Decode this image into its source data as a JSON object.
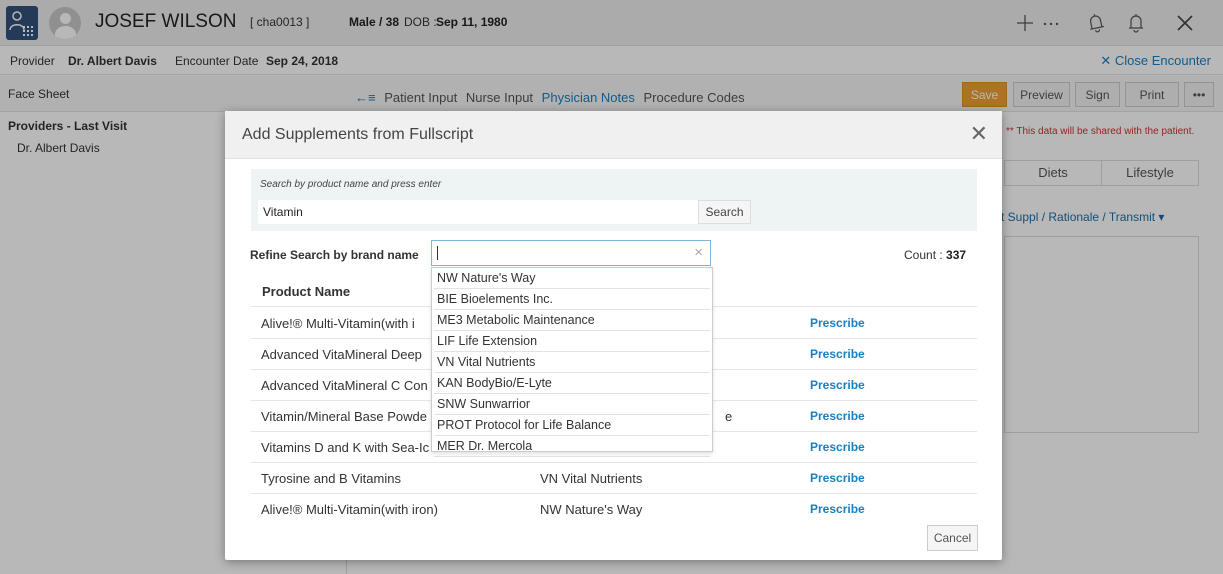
{
  "header": {
    "patient_name": "JOSEF WILSON",
    "patient_id": "[ cha0013 ]",
    "sex_age": "Male / 38",
    "dob_label": "DOB :",
    "dob": "Sep 11, 1980"
  },
  "encounter": {
    "provider_label": "Provider",
    "provider": "Dr. Albert Davis",
    "date_label": "Encounter Date",
    "date": "Sep 24, 2018",
    "close_label": "✕ Close Encounter"
  },
  "tabbar": {
    "face_sheet": "Face Sheet",
    "back_icon": "←≡",
    "tabs": [
      "Patient Input",
      "Nurse Input",
      "Physician Notes",
      "Procedure Codes"
    ],
    "save": "Save",
    "preview": "Preview",
    "sign": "Sign",
    "print": "Print",
    "more": "•••"
  },
  "left_panel": {
    "title": "Providers - Last Visit",
    "provider": "Dr. Albert Davis"
  },
  "right_panel": {
    "shared_note": "** This data will be shared with the patient.",
    "tab_diets": "Diets",
    "tab_lifestyle": "Lifestyle",
    "links": "t Suppl  /  Rationale  /  Transmit ▾"
  },
  "modal": {
    "title": "Add Supplements from Fullscript",
    "search_hint": "Search by product name and press enter",
    "search_value": "Vitamin",
    "search_button": "Search",
    "refine_label": "Refine Search by brand name",
    "count_label": "Count :",
    "count_value": "337",
    "column_product": "Product Name",
    "prescribe_label": "Prescribe",
    "cancel": "Cancel",
    "rows": [
      {
        "name": "Alive!® Multi-Vitamin(with i",
        "brand": ""
      },
      {
        "name": "Advanced VitaMineral Deep",
        "brand": ""
      },
      {
        "name": "Advanced VitaMineral C Con",
        "brand": ""
      },
      {
        "name": "Vitamin/Mineral Base Powde",
        "brand": "e"
      },
      {
        "name": "Vitamins D and K with Sea-Ic",
        "brand": ""
      },
      {
        "name": "Tyrosine and B Vitamins",
        "brand": "VN Vital Nutrients"
      },
      {
        "name": "Alive!® Multi-Vitamin(with iron)",
        "brand": "NW Nature's Way"
      }
    ],
    "brand_options": [
      "NW Nature's Way",
      "BIE Bioelements Inc.",
      "ME3 Metabolic Maintenance",
      "LIF Life Extension",
      "VN Vital Nutrients",
      "KAN BodyBio/E-Lyte",
      "SNW Sunwarrior",
      "PROT Protocol for Life Balance",
      "MER Dr. Mercola"
    ]
  },
  "colors": {
    "accent": "#1a7fc1",
    "save": "#f0a030",
    "logo": "#31527c"
  },
  "icons": [
    "app-logo-icon",
    "avatar-icon",
    "plus-icon",
    "ellipsis-icon",
    "bell-ring-icon",
    "bell-icon",
    "close-icon"
  ]
}
